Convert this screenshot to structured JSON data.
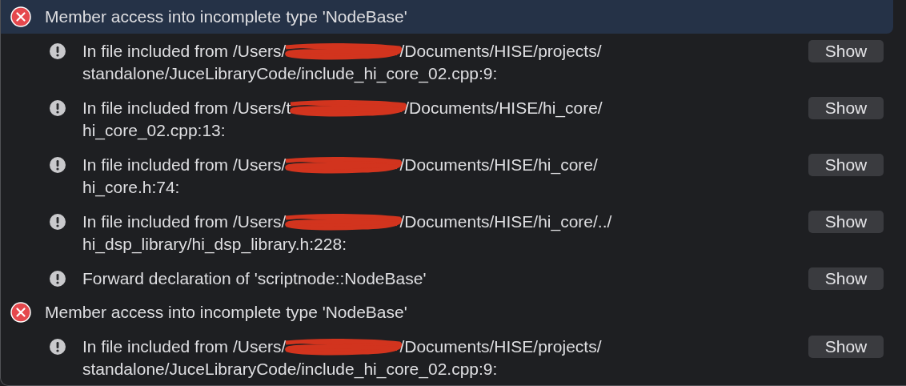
{
  "issues": [
    {
      "kind": "error",
      "selected": true,
      "text": "Member access into incomplete type 'NodeBase'"
    },
    {
      "kind": "note",
      "text_before": "In file included from /Users/",
      "redacted": true,
      "text_after": "/Documents/HISE/projects/",
      "line_2": "standalone/JuceLibraryCode/include_hi_core_02.cpp:9:",
      "button": "Show"
    },
    {
      "kind": "note",
      "text_before": "In file included from /Users/t",
      "redacted": true,
      "text_after": "/Documents/HISE/hi_core/",
      "line_2": "hi_core_02.cpp:13:",
      "button": "Show"
    },
    {
      "kind": "note",
      "text_before": "In file included from /Users/",
      "redacted": true,
      "text_after": "/Documents/HISE/hi_core/",
      "line_2": "hi_core.h:74:",
      "button": "Show"
    },
    {
      "kind": "note",
      "text_before": "In file included from /Users/",
      "redacted": true,
      "text_after": "/Documents/HISE/hi_core/../",
      "line_2": "hi_dsp_library/hi_dsp_library.h:228:",
      "button": "Show"
    },
    {
      "kind": "note",
      "text_before": "Forward declaration of 'scriptnode::NodeBase'",
      "redacted": false,
      "button": "Show"
    },
    {
      "kind": "error",
      "selected": false,
      "text": "Member access into incomplete type 'NodeBase'"
    },
    {
      "kind": "note",
      "text_before": "In file included from /Users/",
      "redacted": true,
      "text_after": "/Documents/HISE/projects/",
      "line_2": "standalone/JuceLibraryCode/include_hi_core_02.cpp:9:",
      "button": "Show"
    }
  ]
}
